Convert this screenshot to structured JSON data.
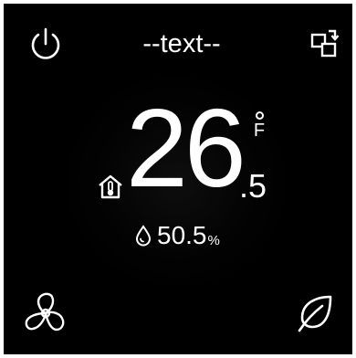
{
  "header": {
    "title": "--text--",
    "power_icon": "power-icon",
    "switch_icon": "switch-windows-icon"
  },
  "thermostat": {
    "temperature_integer": "26",
    "temperature_decimal": ".5",
    "unit_letter": "F",
    "indoor_icon": "home-thermometer-icon"
  },
  "humidity": {
    "icon": "water-drop-icon",
    "value": "50.5",
    "unit": "%"
  },
  "footer": {
    "fan_icon": "fan-icon",
    "eco_icon": "leaf-icon"
  },
  "colors": {
    "background": "#000000",
    "foreground": "#ffffff"
  }
}
